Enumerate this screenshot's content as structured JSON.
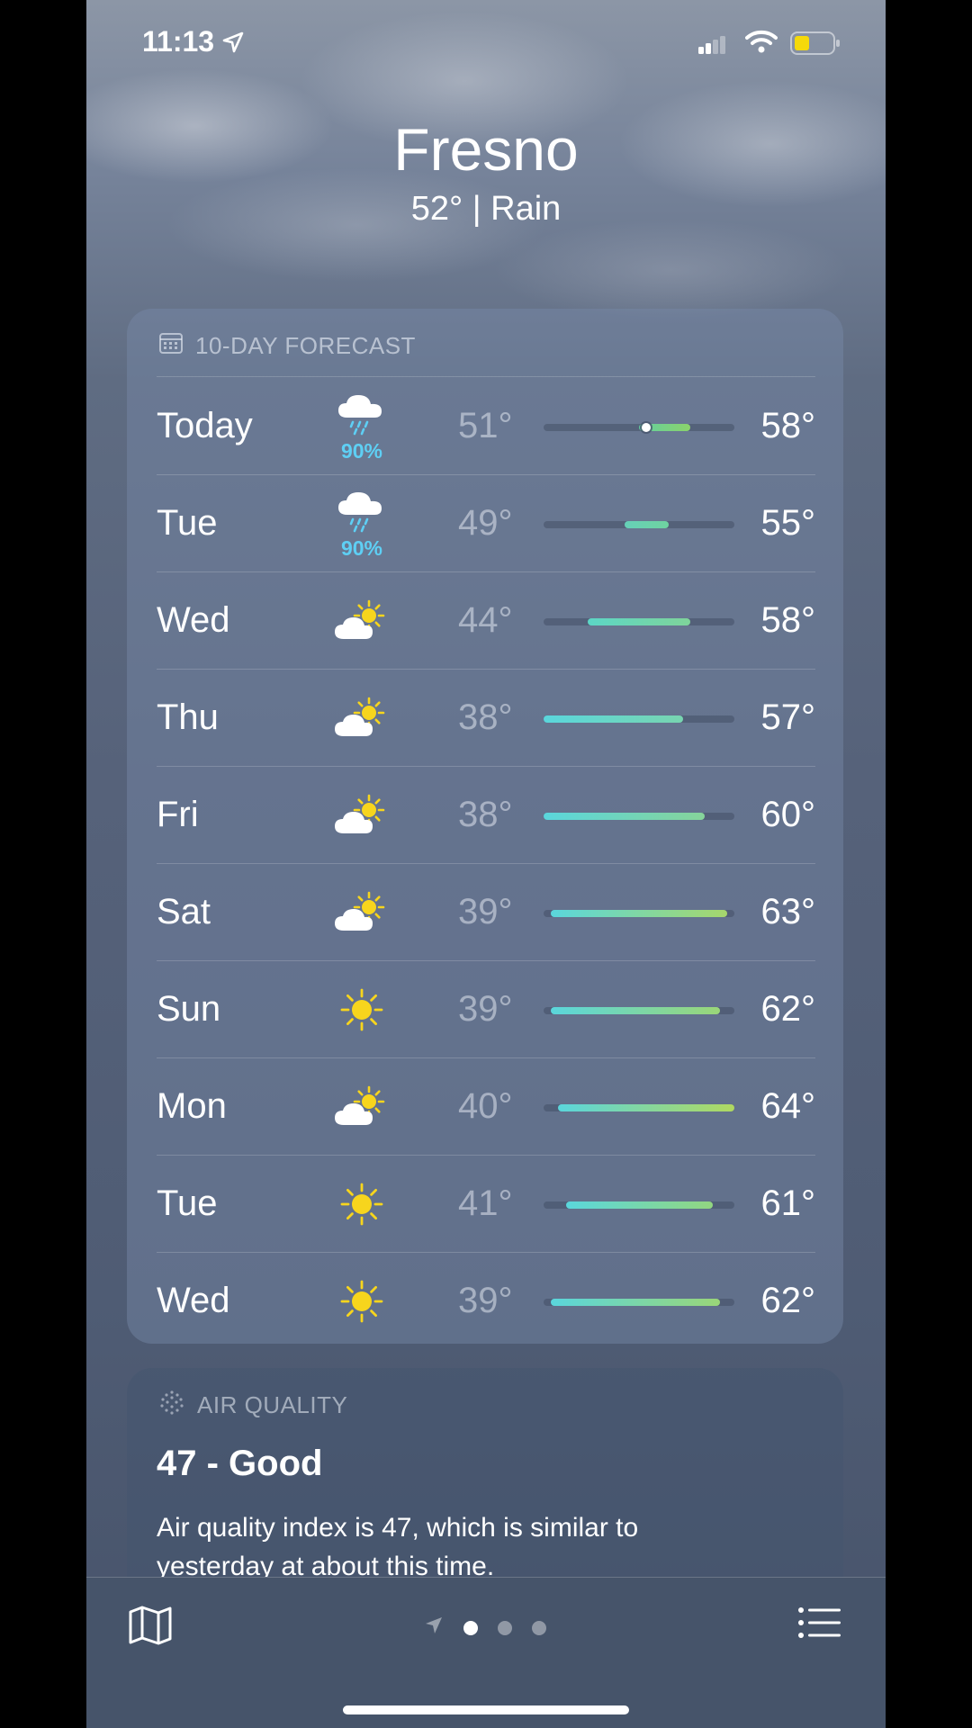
{
  "status_bar": {
    "time": "11:13",
    "icons": [
      "location-arrow-icon",
      "signal-icon",
      "wifi-icon",
      "battery-icon"
    ],
    "battery_color": "#f5d90a"
  },
  "location": {
    "city": "Fresno",
    "current": "52° | Rain"
  },
  "forecast": {
    "header": "10-DAY FORECAST",
    "header_icon": "calendar-icon",
    "scale": {
      "min": 38,
      "max": 64
    },
    "current_temp": 52,
    "days": [
      {
        "day": "Today",
        "icon": "cloud-rain-icon",
        "precip": "90%",
        "low": "51°",
        "high": "58°",
        "low_val": 51,
        "high_val": 58,
        "bar_colors": [
          "#63d0a0",
          "#8bd36b"
        ],
        "has_current_dot": true
      },
      {
        "day": "Tue",
        "icon": "cloud-rain-icon",
        "precip": "90%",
        "low": "49°",
        "high": "55°",
        "low_val": 49,
        "high_val": 55,
        "bar_colors": [
          "#66d0b8",
          "#6fd3a0"
        ]
      },
      {
        "day": "Wed",
        "icon": "partly-sunny-icon",
        "low": "44°",
        "high": "58°",
        "low_val": 44,
        "high_val": 58,
        "bar_colors": [
          "#5cd6c6",
          "#7fd49a"
        ]
      },
      {
        "day": "Thu",
        "icon": "partly-sunny-icon",
        "low": "38°",
        "high": "57°",
        "low_val": 38,
        "high_val": 57,
        "bar_colors": [
          "#5ad6dc",
          "#78d5b0"
        ]
      },
      {
        "day": "Fri",
        "icon": "partly-sunny-icon",
        "low": "38°",
        "high": "60°",
        "low_val": 38,
        "high_val": 60,
        "bar_colors": [
          "#5ad6dc",
          "#86d49a"
        ]
      },
      {
        "day": "Sat",
        "icon": "partly-sunny-icon",
        "low": "39°",
        "high": "63°",
        "low_val": 39,
        "high_val": 63,
        "bar_colors": [
          "#5ad6dc",
          "#a6d66c"
        ]
      },
      {
        "day": "Sun",
        "icon": "sun-icon",
        "low": "39°",
        "high": "62°",
        "low_val": 39,
        "high_val": 62,
        "bar_colors": [
          "#5ad6dc",
          "#9ad678"
        ]
      },
      {
        "day": "Mon",
        "icon": "partly-sunny-icon",
        "low": "40°",
        "high": "64°",
        "low_val": 40,
        "high_val": 64,
        "bar_colors": [
          "#5ad6dc",
          "#b0d860"
        ]
      },
      {
        "day": "Tue",
        "icon": "sun-icon",
        "low": "41°",
        "high": "61°",
        "low_val": 41,
        "high_val": 61,
        "bar_colors": [
          "#5ad6dc",
          "#92d680"
        ]
      },
      {
        "day": "Wed",
        "icon": "sun-icon",
        "low": "39°",
        "high": "62°",
        "low_val": 39,
        "high_val": 62,
        "bar_colors": [
          "#5ad6dc",
          "#9ad678"
        ]
      }
    ]
  },
  "air_quality": {
    "header": "AIR QUALITY",
    "header_icon": "air-quality-icon",
    "value": "47 - Good",
    "description": "Air quality index is 47, which is similar to yesterday at about this time."
  },
  "bottom_bar": {
    "left_icon": "map-icon",
    "right_icon": "list-icon",
    "pages": 3,
    "active_page": 0
  }
}
